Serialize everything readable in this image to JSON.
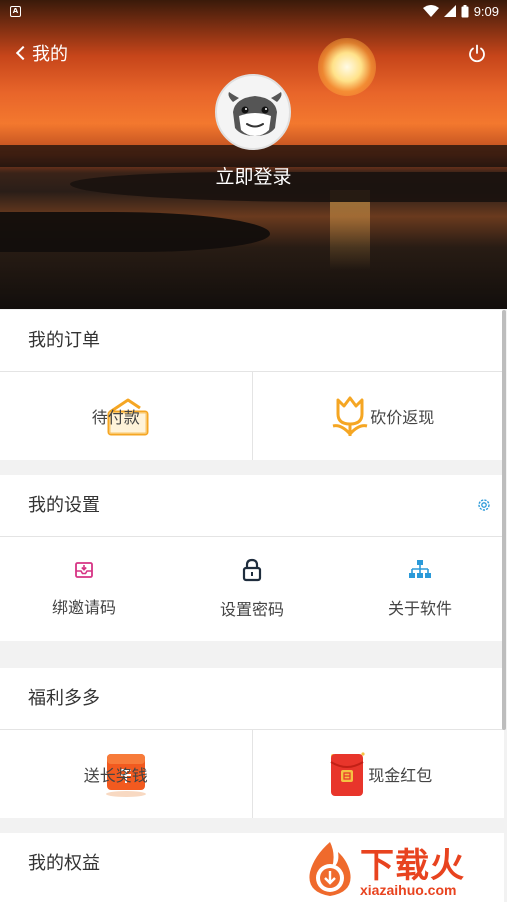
{
  "status_bar": {
    "time": "9:09"
  },
  "header": {
    "back_label": "我的",
    "login_label": "立即登录"
  },
  "orders": {
    "title": "我的订单",
    "items": [
      {
        "label": "待付款",
        "icon": "wallet-icon"
      },
      {
        "label": "砍价返现",
        "icon": "tulip-icon"
      }
    ]
  },
  "settings": {
    "title": "我的设置",
    "items": [
      {
        "label": "绑邀请码",
        "icon": "inbox-icon"
      },
      {
        "label": "设置密码",
        "icon": "lock-icon"
      },
      {
        "label": "关于软件",
        "icon": "hierarchy-icon"
      }
    ]
  },
  "welfare": {
    "title": "福利多多",
    "items": [
      {
        "label": "送长奖钱",
        "icon": "cash-box-icon"
      },
      {
        "label": "现金红包",
        "icon": "red-envelope-icon"
      }
    ]
  },
  "rights": {
    "title": "我的权益"
  },
  "watermark": {
    "brand": "下载火",
    "url": "xiazaihuo.com"
  },
  "colors": {
    "accent_orange": "#f5a623",
    "settings_blue": "#2b9ad9",
    "brand_red": "#e8431f"
  }
}
